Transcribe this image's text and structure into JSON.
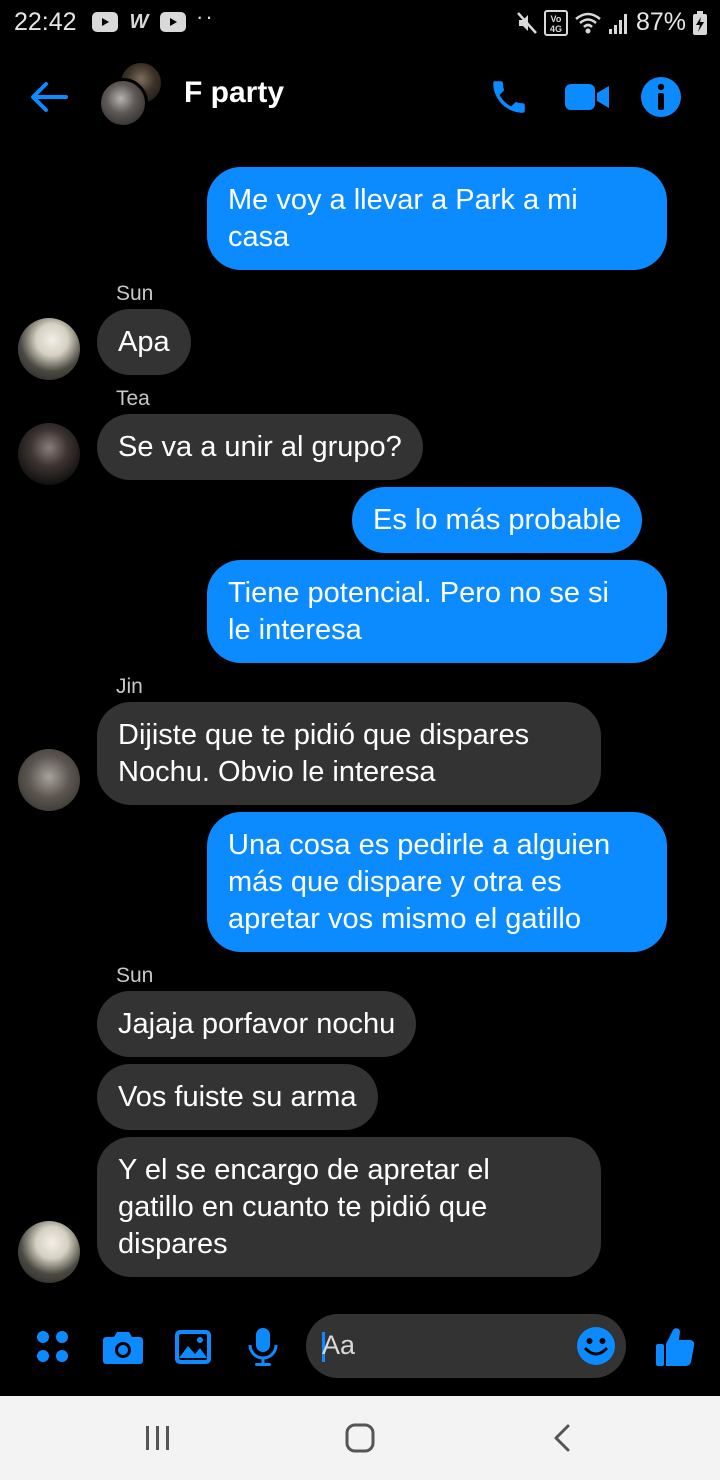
{
  "status_bar": {
    "time": "22:42",
    "battery": "87%",
    "network": "VoLTE 4G"
  },
  "header": {
    "title": "F party",
    "icons": [
      "back-arrow-icon",
      "phone-icon",
      "video-camera-icon",
      "info-icon"
    ]
  },
  "messages": [
    {
      "dir": "out",
      "lines": [
        "Me voy a llevar a Park a mi",
        "casa"
      ]
    },
    {
      "sender": "Sun"
    },
    {
      "dir": "in",
      "lines": [
        "Apa"
      ]
    },
    {
      "sender": "Tea"
    },
    {
      "dir": "in",
      "lines": [
        "Se va a unir al grupo?"
      ]
    },
    {
      "dir": "out",
      "lines": [
        "Es lo más probable"
      ]
    },
    {
      "dir": "out",
      "lines": [
        "Tiene potencial. Pero no se si",
        "le interesa"
      ]
    },
    {
      "sender": "Jin"
    },
    {
      "dir": "in",
      "lines": [
        "Dijiste que te pidió que dispares",
        "Nochu. Obvio le interesa"
      ]
    },
    {
      "dir": "out",
      "lines": [
        "Una cosa es pedirle a alguien",
        "más que dispare y otra es",
        "apretar vos mismo el gatillo"
      ]
    },
    {
      "sender": "Sun"
    },
    {
      "dir": "in",
      "lines": [
        "Jajaja porfavor nochu"
      ]
    },
    {
      "dir": "in",
      "lines": [
        "Vos fuiste su arma"
      ]
    },
    {
      "dir": "in",
      "lines": [
        "Y el se encargo de apretar el",
        "gatillo en cuanto te pidió que",
        "dispares"
      ]
    }
  ],
  "composer": {
    "placeholder": "Aa",
    "icons": [
      "apps-grid-icon",
      "camera-icon",
      "gallery-icon",
      "microphone-icon",
      "emoji-icon",
      "thumbs-up-icon"
    ]
  },
  "navbar": {
    "icons": [
      "recent-apps-icon",
      "home-icon",
      "back-icon"
    ]
  },
  "colors": {
    "accent": "#0b8bff",
    "incoming_bubble": "#333333",
    "background": "#000000"
  }
}
